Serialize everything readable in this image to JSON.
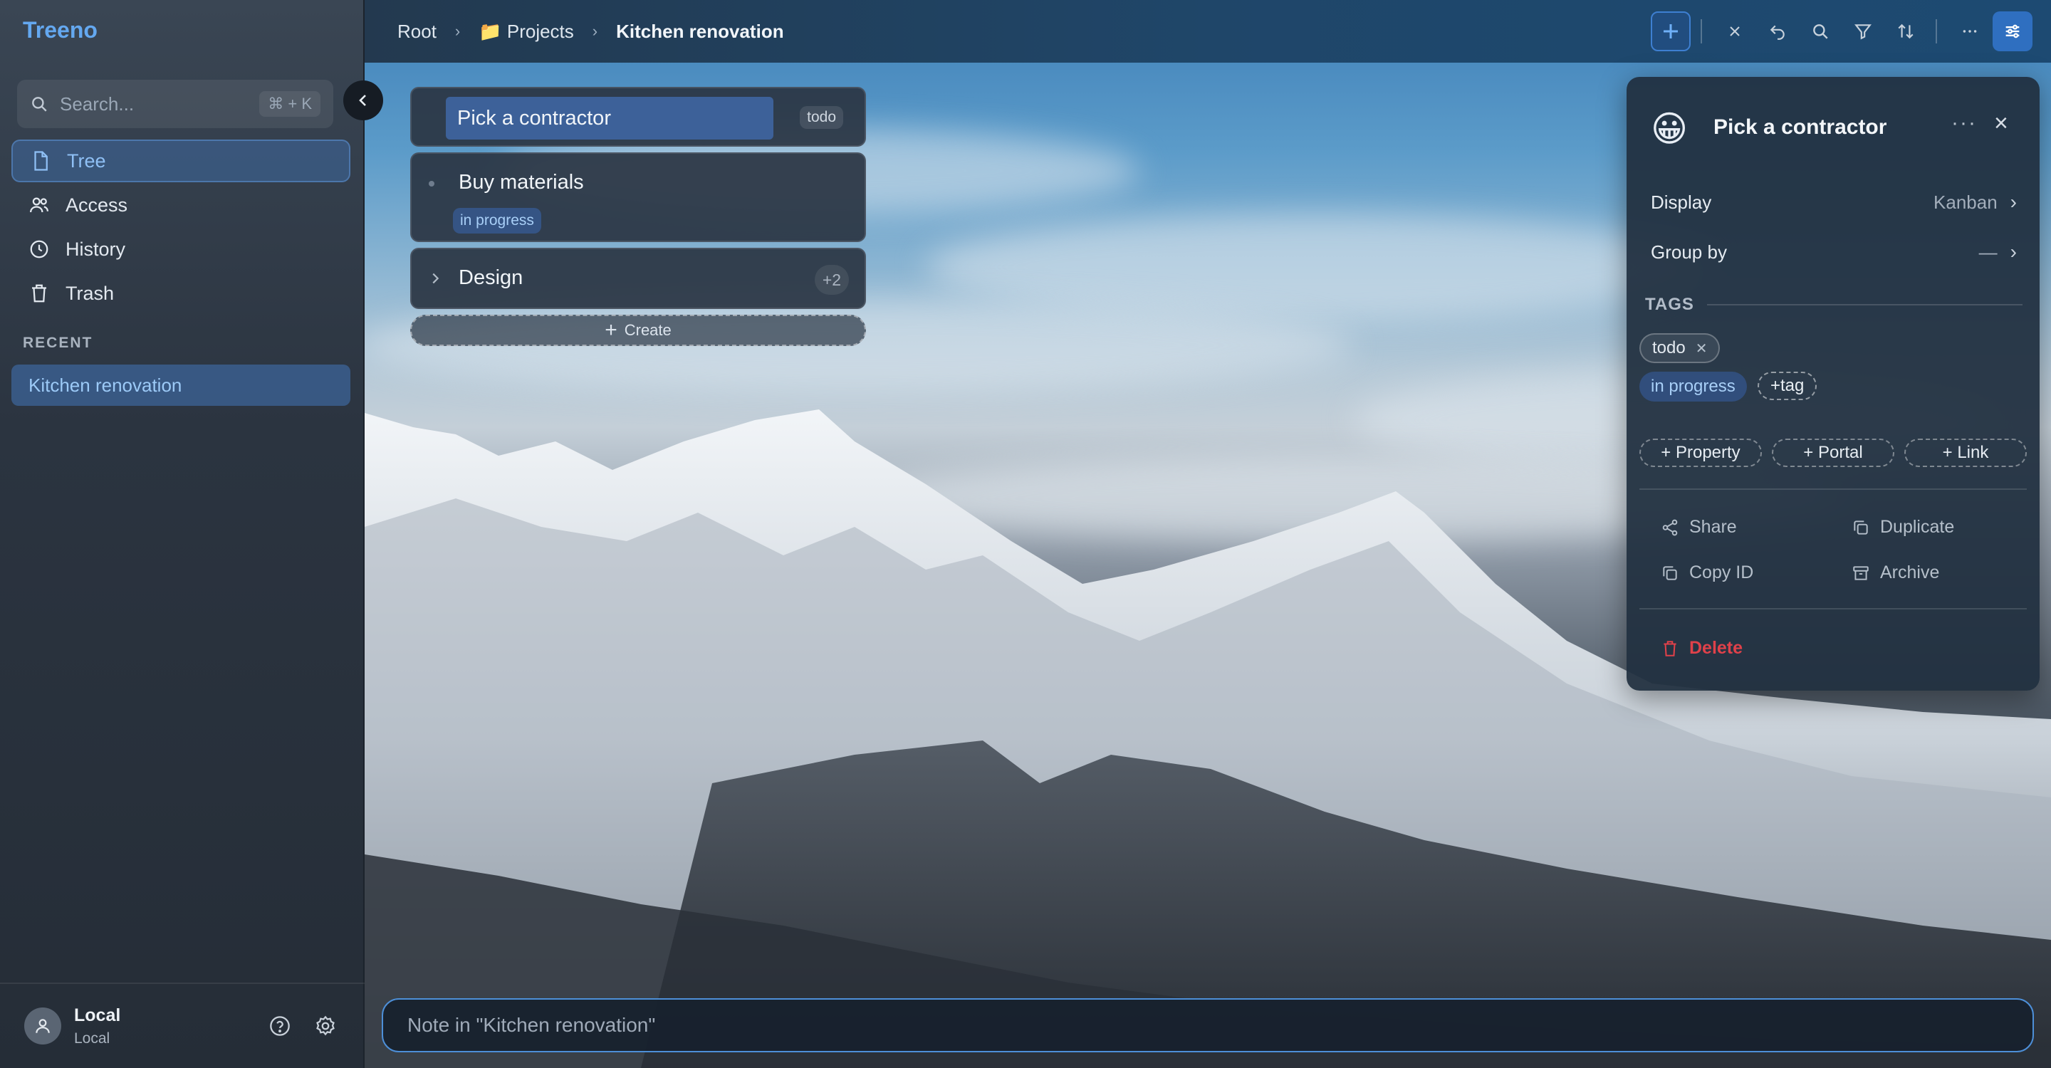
{
  "app": {
    "name": "Treeno"
  },
  "search": {
    "placeholder": "Search...",
    "shortcut": "⌘ + K"
  },
  "nav": {
    "items": [
      {
        "label": "Tree",
        "icon": "file-icon",
        "active": true
      },
      {
        "label": "Access",
        "icon": "users-icon",
        "active": false
      },
      {
        "label": "History",
        "icon": "clock-icon",
        "active": false
      },
      {
        "label": "Trash",
        "icon": "trash-icon",
        "active": false
      }
    ]
  },
  "recent": {
    "header": "RECENT",
    "items": [
      {
        "label": "Kitchen renovation"
      }
    ]
  },
  "user": {
    "name": "Local",
    "subtitle": "Local"
  },
  "breadcrumb": {
    "items": [
      {
        "label": "Root"
      },
      {
        "label": "Projects",
        "icon": "📁"
      },
      {
        "label": "Kitchen renovation"
      }
    ]
  },
  "cards": [
    {
      "title": "Pick a contractor",
      "tag": "todo",
      "selected": true
    },
    {
      "title": "Buy materials",
      "tag": "in progress"
    },
    {
      "title": "Design",
      "count": "+2"
    }
  ],
  "create": {
    "label": "Create"
  },
  "panel": {
    "emoji": "😀",
    "title": "Pick a contractor",
    "rows": [
      {
        "label": "Display",
        "value": "Kanban"
      },
      {
        "label": "Group by",
        "value": "—"
      }
    ],
    "tags_header": "TAGS",
    "tags": [
      "todo",
      "in progress"
    ],
    "add_tag": "+tag",
    "buttons": [
      "+ Property",
      "+ Portal",
      "+ Link"
    ],
    "actions": {
      "share": "Share",
      "duplicate": "Duplicate",
      "copy_id": "Copy ID",
      "archive": "Archive",
      "delete": "Delete"
    }
  },
  "note": {
    "placeholder": "Note in \"Kitchen renovation\""
  },
  "colors": {
    "accent": "#4d8fd8",
    "danger": "#e0414a",
    "brand": "#64a8f0"
  }
}
